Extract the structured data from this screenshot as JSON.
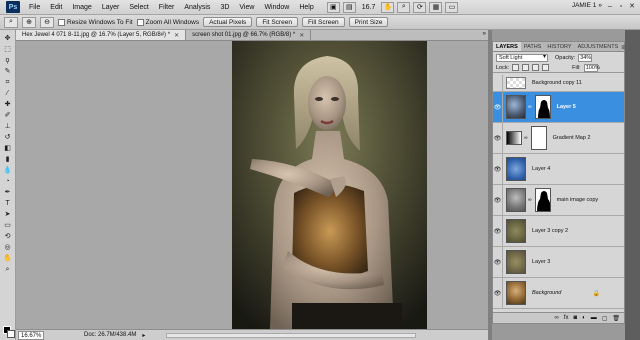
{
  "menubar": {
    "logo": "Ps",
    "items": [
      "File",
      "Edit",
      "Image",
      "Layer",
      "Select",
      "Filter",
      "Analysis",
      "3D",
      "View",
      "Window",
      "Help"
    ],
    "zoom": "16.7",
    "workspace": "JAMIE 1"
  },
  "options": {
    "resize_windows": "Resize Windows To Fit",
    "zoom_all": "Zoom All Windows",
    "actual_pixels": "Actual Pixels",
    "fit_screen": "Fit Screen",
    "fill_screen": "Fill Screen",
    "print_size": "Print Size"
  },
  "tabs": [
    {
      "label": "Hex Jewel 4 071 8-11.jpg @ 16.7% (Layer 5, RGB/8#) *"
    },
    {
      "label": "screen shot 01.jpg @ 66.7% (RGB/8) *"
    }
  ],
  "status": {
    "zoom": "16.67%",
    "doc": "Doc: 26.7M/438.4M"
  },
  "layers_panel": {
    "tabs": [
      "LAYERS",
      "PATHS",
      "HISTORY",
      "ADJUSTMENTS"
    ],
    "blend_mode": "Soft Light",
    "opacity_label": "Opacity:",
    "opacity": "34%",
    "lock_label": "Lock:",
    "fill_label": "Fill:",
    "fill": "100%",
    "layers": [
      {
        "name": "Background copy 11"
      },
      {
        "name": "Layer 5"
      },
      {
        "name": "Gradient Map 2"
      },
      {
        "name": "Layer 4"
      },
      {
        "name": "main image copy"
      },
      {
        "name": "Layer 3 copy 2"
      },
      {
        "name": "Layer 3"
      },
      {
        "name": "Background"
      }
    ]
  },
  "colors": {
    "selected_layer": "#3b8fe0",
    "canvas_bg": "#a8a8a8"
  }
}
